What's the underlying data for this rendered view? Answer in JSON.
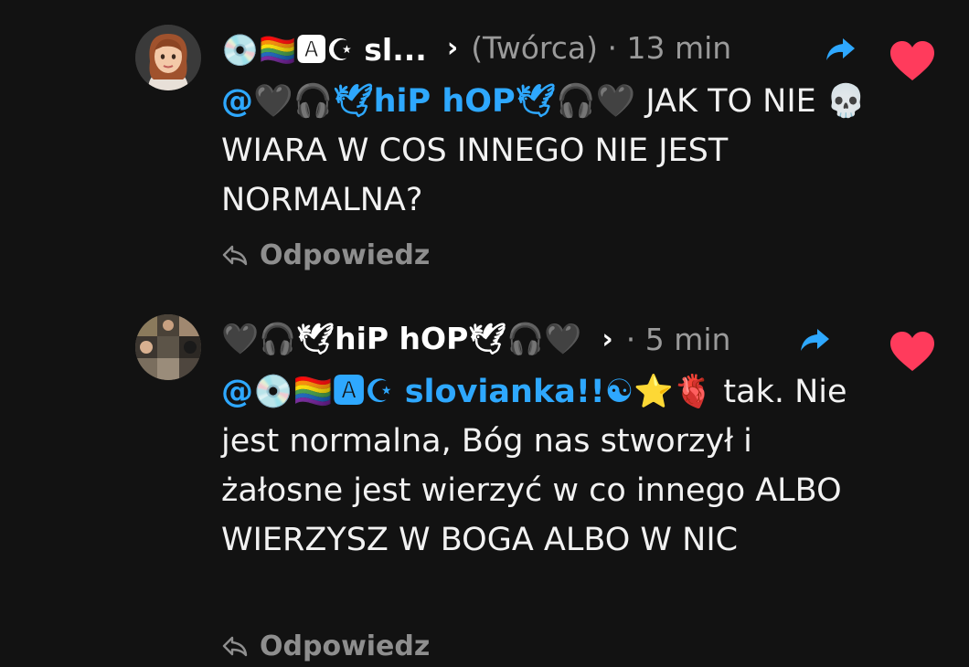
{
  "comments": [
    {
      "header_name": "💿🏳️‍🌈🅰☪ sl...",
      "chevron": "›",
      "meta": "(Twórca) · 13 min",
      "mention": "@🖤🎧🕊hiP hOP🕊🎧🖤",
      "text": " JAK TO NIE 💀 WIARA W COS INNEGO NIE JEST NORMALNA?",
      "reply_label": "Odpowiedz"
    },
    {
      "header_name": "🖤🎧🕊hiP hOP🕊🎧🖤",
      "chevron": "›",
      "meta": "· 5 min",
      "mention": "@💿🏳️‍🌈🅰☪ slovianka!!☯⭐🫀",
      "text": " tak. Nie jest normalna, Bóg nas stworzył i żałosne jest wierzyć w co innego ALBO WIERZYSZ W BOGA ALBO W NIC",
      "reply_label": "Odpowiedz"
    }
  ],
  "colors": {
    "background": "#121212",
    "mention": "#2ea8ff",
    "heart": "#ff3b5c",
    "share": "#2ea8ff",
    "muted": "#9a9a9a"
  },
  "icons": {
    "share": "share-arrow-icon",
    "heart": "heart-icon",
    "reply": "reply-arrow-icon"
  }
}
